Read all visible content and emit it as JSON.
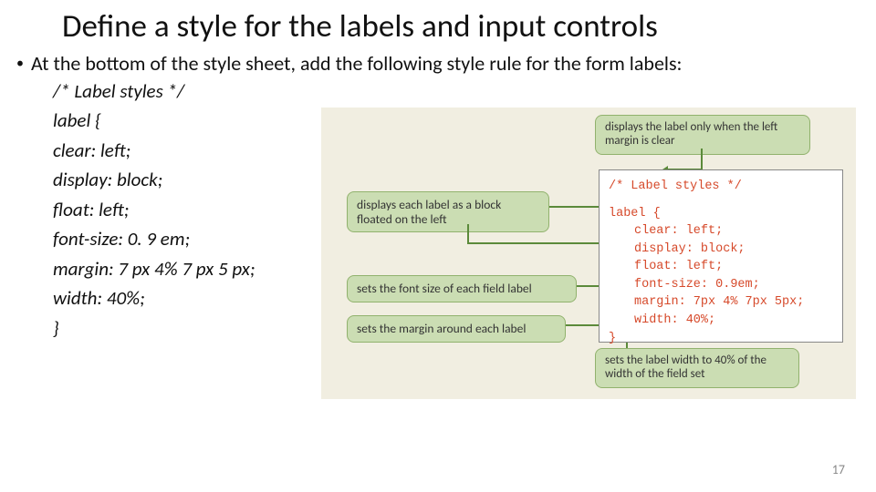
{
  "title": "Define a style for the labels and input controls",
  "bullet": "At the bottom of the style sheet, add the following style rule for the form labels:",
  "code_lines": [
    "/* Label styles */",
    "label {",
    "clear: left;",
    "display: block;",
    "float: left;",
    "font-size: 0. 9 em;",
    "margin: 7 px 4% 7 px 5 px;",
    "width: 40%;",
    "}"
  ],
  "diagram": {
    "callouts": {
      "c1": "displays the label only when the left margin is clear",
      "c2": "displays each label as a block floated on the left",
      "c3": "sets the font size of each field label",
      "c4": "sets the margin around each label",
      "c5": "sets the label width to 40% of the width of the field set"
    },
    "code": {
      "comment": "/* Label styles */",
      "selector": "label {",
      "p1": "clear: left;",
      "p2": "display: block;",
      "p3": "float: left;",
      "p4": "font-size: 0.9em;",
      "p5": "margin: 7px 4% 7px 5px;",
      "p6": "width: 40%;",
      "end": "}"
    }
  },
  "page_number": "17"
}
